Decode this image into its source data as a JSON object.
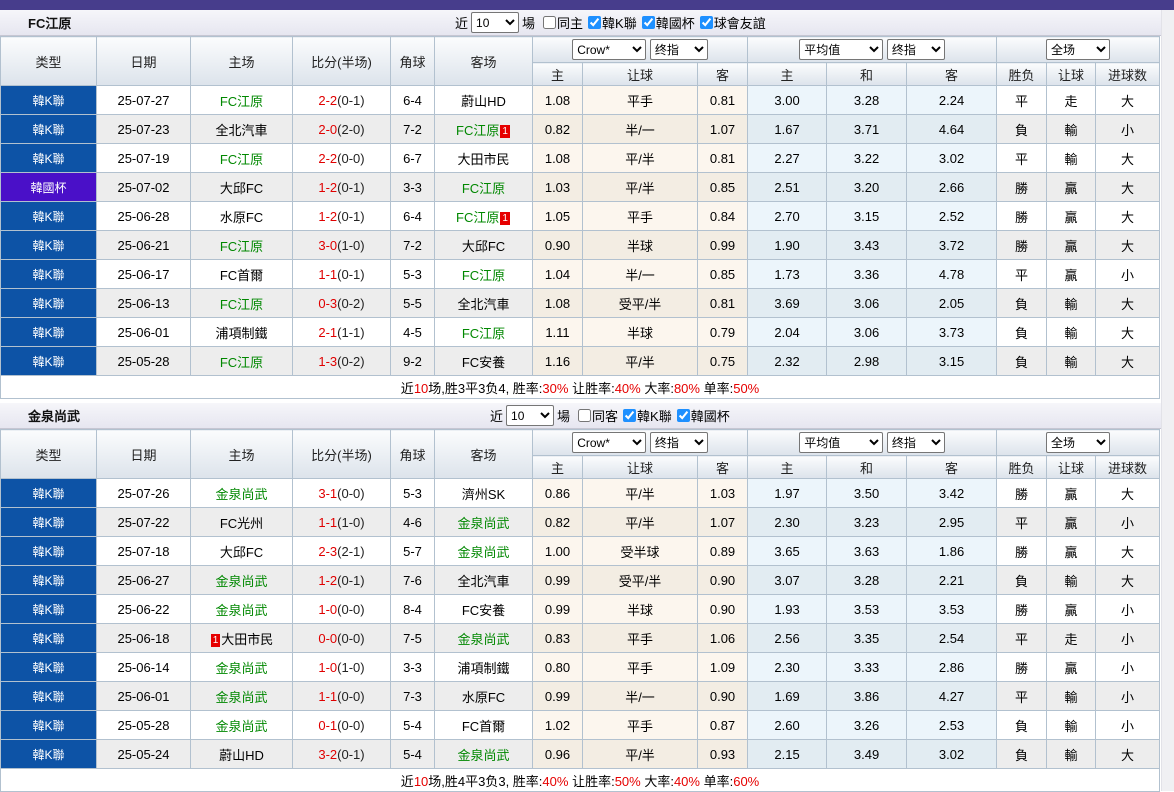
{
  "colors": {
    "topbar_purple": "#473d8c",
    "league_blue": "#0d53a6",
    "cup_purple": "#4a10c8",
    "focus_team_green": "#008800",
    "win_red": "#e00000",
    "draw_green": "#008000",
    "loss_blue": "#0000cc",
    "odds_bg_cream": "#fcf6ee",
    "avg_bg_blue": "#ecf5fb"
  },
  "sections": [
    {
      "team": "FC江原",
      "recent_label": "近",
      "recent_value": "10",
      "games_label": "場",
      "checkboxes": [
        {
          "label": "同主",
          "checked": false
        },
        {
          "label": "韓K聯",
          "checked": true
        },
        {
          "label": "韓國杯",
          "checked": true
        },
        {
          "label": "球會友誼",
          "checked": true
        }
      ],
      "columns": [
        "类型",
        "日期",
        "主场",
        "比分(半场)",
        "角球",
        "客场"
      ],
      "dd_odds_1": "Crow*",
      "dd_odds_2": "终指",
      "dd_avg_1": "平均值",
      "dd_avg_2": "终指",
      "dd_result": "全场",
      "sub": [
        "主",
        "让球",
        "客",
        "主",
        "和",
        "客",
        "胜负",
        "让球",
        "进球数"
      ],
      "rows": [
        {
          "league": "韓K聯",
          "league_key": "k",
          "date": "25-07-27",
          "home": "FC江原",
          "home_focus": true,
          "home_badge": "",
          "score": "2-2",
          "half": "(0-1)",
          "corner": "6-4",
          "away": "蔚山HD",
          "away_focus": false,
          "away_badge": "",
          "odds_home": "1.08",
          "handicap": "平手",
          "odds_away": "0.81",
          "avg_home": "3.00",
          "avg_draw": "3.28",
          "avg_away": "2.24",
          "result": "平",
          "handicap_result": "走",
          "goals_result": "大"
        },
        {
          "league": "韓K聯",
          "league_key": "k",
          "date": "25-07-23",
          "home": "全北汽車",
          "home_focus": false,
          "home_badge": "",
          "score": "2-0",
          "half": "(2-0)",
          "corner": "7-2",
          "away": "FC江原",
          "away_focus": true,
          "away_badge": "1",
          "odds_home": "0.82",
          "handicap": "半/一",
          "odds_away": "1.07",
          "avg_home": "1.67",
          "avg_draw": "3.71",
          "avg_away": "4.64",
          "result": "負",
          "handicap_result": "輸",
          "goals_result": "小"
        },
        {
          "league": "韓K聯",
          "league_key": "k",
          "date": "25-07-19",
          "home": "FC江原",
          "home_focus": true,
          "home_badge": "",
          "score": "2-2",
          "half": "(0-0)",
          "corner": "6-7",
          "away": "大田市民",
          "away_focus": false,
          "away_badge": "",
          "odds_home": "1.08",
          "handicap": "平/半",
          "odds_away": "0.81",
          "avg_home": "2.27",
          "avg_draw": "3.22",
          "avg_away": "3.02",
          "result": "平",
          "handicap_result": "輸",
          "goals_result": "大"
        },
        {
          "league": "韓國杯",
          "league_key": "cup",
          "date": "25-07-02",
          "home": "大邱FC",
          "home_focus": false,
          "home_badge": "",
          "score": "1-2",
          "half": "(0-1)",
          "corner": "3-3",
          "away": "FC江原",
          "away_focus": true,
          "away_badge": "",
          "odds_home": "1.03",
          "handicap": "平/半",
          "odds_away": "0.85",
          "avg_home": "2.51",
          "avg_draw": "3.20",
          "avg_away": "2.66",
          "result": "勝",
          "handicap_result": "贏",
          "goals_result": "大"
        },
        {
          "league": "韓K聯",
          "league_key": "k",
          "date": "25-06-28",
          "home": "水原FC",
          "home_focus": false,
          "home_badge": "",
          "score": "1-2",
          "half": "(0-1)",
          "corner": "6-4",
          "away": "FC江原",
          "away_focus": true,
          "away_badge": "1",
          "odds_home": "1.05",
          "handicap": "平手",
          "odds_away": "0.84",
          "avg_home": "2.70",
          "avg_draw": "3.15",
          "avg_away": "2.52",
          "result": "勝",
          "handicap_result": "贏",
          "goals_result": "大"
        },
        {
          "league": "韓K聯",
          "league_key": "k",
          "date": "25-06-21",
          "home": "FC江原",
          "home_focus": true,
          "home_badge": "",
          "score": "3-0",
          "half": "(1-0)",
          "corner": "7-2",
          "away": "大邱FC",
          "away_focus": false,
          "away_badge": "",
          "odds_home": "0.90",
          "handicap": "半球",
          "odds_away": "0.99",
          "avg_home": "1.90",
          "avg_draw": "3.43",
          "avg_away": "3.72",
          "result": "勝",
          "handicap_result": "贏",
          "goals_result": "大"
        },
        {
          "league": "韓K聯",
          "league_key": "k",
          "date": "25-06-17",
          "home": "FC首爾",
          "home_focus": false,
          "home_badge": "",
          "score": "1-1",
          "half": "(0-1)",
          "corner": "5-3",
          "away": "FC江原",
          "away_focus": true,
          "away_badge": "",
          "odds_home": "1.04",
          "handicap": "半/一",
          "odds_away": "0.85",
          "avg_home": "1.73",
          "avg_draw": "3.36",
          "avg_away": "4.78",
          "result": "平",
          "handicap_result": "贏",
          "goals_result": "小"
        },
        {
          "league": "韓K聯",
          "league_key": "k",
          "date": "25-06-13",
          "home": "FC江原",
          "home_focus": true,
          "home_badge": "",
          "score": "0-3",
          "half": "(0-2)",
          "corner": "5-5",
          "away": "全北汽車",
          "away_focus": false,
          "away_badge": "",
          "odds_home": "1.08",
          "handicap": "受平/半",
          "odds_away": "0.81",
          "avg_home": "3.69",
          "avg_draw": "3.06",
          "avg_away": "2.05",
          "result": "負",
          "handicap_result": "輸",
          "goals_result": "大"
        },
        {
          "league": "韓K聯",
          "league_key": "k",
          "date": "25-06-01",
          "home": "浦項制鐵",
          "home_focus": false,
          "home_badge": "",
          "score": "2-1",
          "half": "(1-1)",
          "corner": "4-5",
          "away": "FC江原",
          "away_focus": true,
          "away_badge": "",
          "odds_home": "1.11",
          "handicap": "半球",
          "odds_away": "0.79",
          "avg_home": "2.04",
          "avg_draw": "3.06",
          "avg_away": "3.73",
          "result": "負",
          "handicap_result": "輸",
          "goals_result": "大"
        },
        {
          "league": "韓K聯",
          "league_key": "k",
          "date": "25-05-28",
          "home": "FC江原",
          "home_focus": true,
          "home_badge": "",
          "score": "1-3",
          "half": "(0-2)",
          "corner": "9-2",
          "away": "FC安養",
          "away_focus": false,
          "away_badge": "",
          "odds_home": "1.16",
          "handicap": "平/半",
          "odds_away": "0.75",
          "avg_home": "2.32",
          "avg_draw": "2.98",
          "avg_away": "3.15",
          "result": "負",
          "handicap_result": "輸",
          "goals_result": "大"
        }
      ],
      "summary": [
        [
          "近",
          0
        ],
        [
          "10",
          1
        ],
        [
          "场,胜3平3负4, 胜率:",
          0
        ],
        [
          "30%",
          1
        ],
        [
          " 让胜率:",
          0
        ],
        [
          "40%",
          1
        ],
        [
          " 大率:",
          0
        ],
        [
          "80%",
          1
        ],
        [
          " 单率:",
          0
        ],
        [
          "50%",
          1
        ]
      ]
    },
    {
      "team": "金泉尚武",
      "recent_label": "近",
      "recent_value": "10",
      "games_label": "場",
      "checkboxes": [
        {
          "label": "同客",
          "checked": false
        },
        {
          "label": "韓K聯",
          "checked": true
        },
        {
          "label": "韓國杯",
          "checked": true
        }
      ],
      "columns": [
        "类型",
        "日期",
        "主场",
        "比分(半场)",
        "角球",
        "客场"
      ],
      "dd_odds_1": "Crow*",
      "dd_odds_2": "终指",
      "dd_avg_1": "平均值",
      "dd_avg_2": "终指",
      "dd_result": "全场",
      "sub": [
        "主",
        "让球",
        "客",
        "主",
        "和",
        "客",
        "胜负",
        "让球",
        "进球数"
      ],
      "rows": [
        {
          "league": "韓K聯",
          "league_key": "k",
          "date": "25-07-26",
          "home": "金泉尚武",
          "home_focus": true,
          "home_badge": "",
          "score": "3-1",
          "half": "(0-0)",
          "corner": "5-3",
          "away": "濟州SK",
          "away_focus": false,
          "away_badge": "",
          "odds_home": "0.86",
          "handicap": "平/半",
          "odds_away": "1.03",
          "avg_home": "1.97",
          "avg_draw": "3.50",
          "avg_away": "3.42",
          "result": "勝",
          "handicap_result": "贏",
          "goals_result": "大"
        },
        {
          "league": "韓K聯",
          "league_key": "k",
          "date": "25-07-22",
          "home": "FC光州",
          "home_focus": false,
          "home_badge": "",
          "score": "1-1",
          "half": "(1-0)",
          "corner": "4-6",
          "away": "金泉尚武",
          "away_focus": true,
          "away_badge": "",
          "odds_home": "0.82",
          "handicap": "平/半",
          "odds_away": "1.07",
          "avg_home": "2.30",
          "avg_draw": "3.23",
          "avg_away": "2.95",
          "result": "平",
          "handicap_result": "贏",
          "goals_result": "小"
        },
        {
          "league": "韓K聯",
          "league_key": "k",
          "date": "25-07-18",
          "home": "大邱FC",
          "home_focus": false,
          "home_badge": "",
          "score": "2-3",
          "half": "(2-1)",
          "corner": "5-7",
          "away": "金泉尚武",
          "away_focus": true,
          "away_badge": "",
          "odds_home": "1.00",
          "handicap": "受半球",
          "odds_away": "0.89",
          "avg_home": "3.65",
          "avg_draw": "3.63",
          "avg_away": "1.86",
          "result": "勝",
          "handicap_result": "贏",
          "goals_result": "大"
        },
        {
          "league": "韓K聯",
          "league_key": "k",
          "date": "25-06-27",
          "home": "金泉尚武",
          "home_focus": true,
          "home_badge": "",
          "score": "1-2",
          "half": "(0-1)",
          "corner": "7-6",
          "away": "全北汽車",
          "away_focus": false,
          "away_badge": "",
          "odds_home": "0.99",
          "handicap": "受平/半",
          "odds_away": "0.90",
          "avg_home": "3.07",
          "avg_draw": "3.28",
          "avg_away": "2.21",
          "result": "負",
          "handicap_result": "輸",
          "goals_result": "大"
        },
        {
          "league": "韓K聯",
          "league_key": "k",
          "date": "25-06-22",
          "home": "金泉尚武",
          "home_focus": true,
          "home_badge": "",
          "score": "1-0",
          "half": "(0-0)",
          "corner": "8-4",
          "away": "FC安養",
          "away_focus": false,
          "away_badge": "",
          "odds_home": "0.99",
          "handicap": "半球",
          "odds_away": "0.90",
          "avg_home": "1.93",
          "avg_draw": "3.53",
          "avg_away": "3.53",
          "result": "勝",
          "handicap_result": "贏",
          "goals_result": "小"
        },
        {
          "league": "韓K聯",
          "league_key": "k",
          "date": "25-06-18",
          "home": "大田市民",
          "home_focus": false,
          "home_badge": "1",
          "score": "0-0",
          "half": "(0-0)",
          "corner": "7-5",
          "away": "金泉尚武",
          "away_focus": true,
          "away_badge": "",
          "odds_home": "0.83",
          "handicap": "平手",
          "odds_away": "1.06",
          "avg_home": "2.56",
          "avg_draw": "3.35",
          "avg_away": "2.54",
          "result": "平",
          "handicap_result": "走",
          "goals_result": "小"
        },
        {
          "league": "韓K聯",
          "league_key": "k",
          "date": "25-06-14",
          "home": "金泉尚武",
          "home_focus": true,
          "home_badge": "",
          "score": "1-0",
          "half": "(1-0)",
          "corner": "3-3",
          "away": "浦項制鐵",
          "away_focus": false,
          "away_badge": "",
          "odds_home": "0.80",
          "handicap": "平手",
          "odds_away": "1.09",
          "avg_home": "2.30",
          "avg_draw": "3.33",
          "avg_away": "2.86",
          "result": "勝",
          "handicap_result": "贏",
          "goals_result": "小"
        },
        {
          "league": "韓K聯",
          "league_key": "k",
          "date": "25-06-01",
          "home": "金泉尚武",
          "home_focus": true,
          "home_badge": "",
          "score": "1-1",
          "half": "(0-0)",
          "corner": "7-3",
          "away": "水原FC",
          "away_focus": false,
          "away_badge": "",
          "odds_home": "0.99",
          "handicap": "半/一",
          "odds_away": "0.90",
          "avg_home": "1.69",
          "avg_draw": "3.86",
          "avg_away": "4.27",
          "result": "平",
          "handicap_result": "輸",
          "goals_result": "小"
        },
        {
          "league": "韓K聯",
          "league_key": "k",
          "date": "25-05-28",
          "home": "金泉尚武",
          "home_focus": true,
          "home_badge": "",
          "score": "0-1",
          "half": "(0-0)",
          "corner": "5-4",
          "away": "FC首爾",
          "away_focus": false,
          "away_badge": "",
          "odds_home": "1.02",
          "handicap": "平手",
          "odds_away": "0.87",
          "avg_home": "2.60",
          "avg_draw": "3.26",
          "avg_away": "2.53",
          "result": "負",
          "handicap_result": "輸",
          "goals_result": "小"
        },
        {
          "league": "韓K聯",
          "league_key": "k",
          "date": "25-05-24",
          "home": "蔚山HD",
          "home_focus": false,
          "home_badge": "",
          "score": "3-2",
          "half": "(0-1)",
          "corner": "5-4",
          "away": "金泉尚武",
          "away_focus": true,
          "away_badge": "",
          "odds_home": "0.96",
          "handicap": "平/半",
          "odds_away": "0.93",
          "avg_home": "2.15",
          "avg_draw": "3.49",
          "avg_away": "3.02",
          "result": "負",
          "handicap_result": "輸",
          "goals_result": "大"
        }
      ],
      "summary": [
        [
          "近",
          0
        ],
        [
          "10",
          1
        ],
        [
          "场,胜4平3负3, 胜率:",
          0
        ],
        [
          "40%",
          1
        ],
        [
          " 让胜率:",
          0
        ],
        [
          "50%",
          1
        ],
        [
          " 大率:",
          0
        ],
        [
          "40%",
          1
        ],
        [
          " 单率:",
          0
        ],
        [
          "60%",
          1
        ]
      ]
    }
  ]
}
